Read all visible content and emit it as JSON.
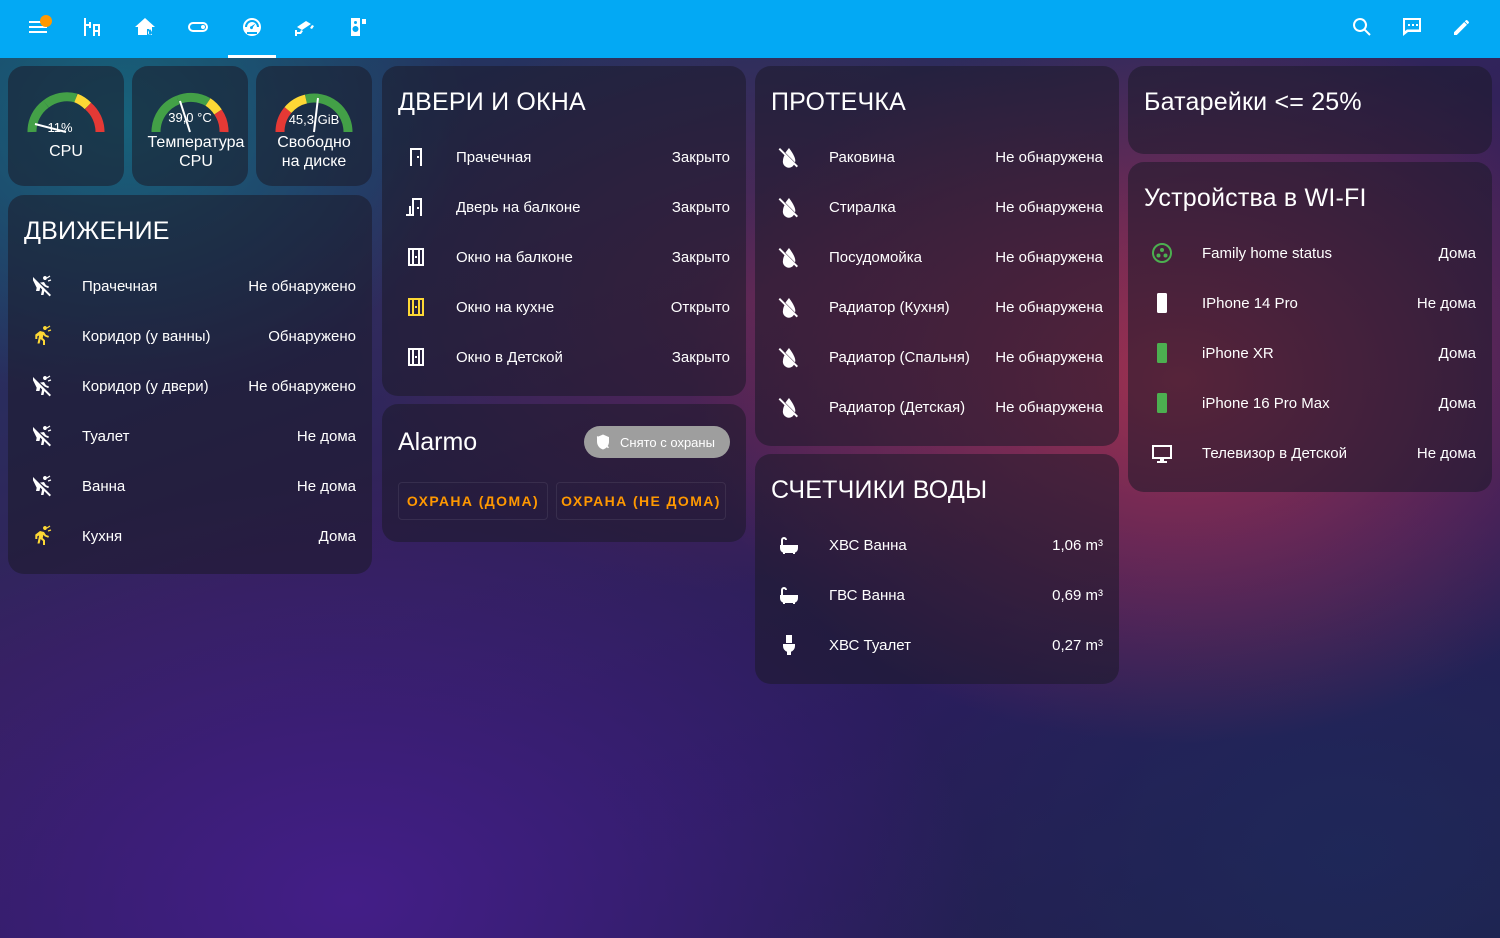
{
  "topbar": {
    "icons": [
      "menu-icon",
      "floor-plan-icon",
      "home-flood-icon",
      "toggle-switch-icon",
      "speedometer-icon",
      "cctv-icon",
      "speaker-icon",
      "search-icon",
      "chat-icon",
      "pencil-icon"
    ],
    "accent": "#03a9f4"
  },
  "gauges": [
    {
      "value": "11%",
      "name": "CPU",
      "level": 0.11
    },
    {
      "value": "39,0 °C",
      "name": "Температура CPU",
      "level": 0.39
    },
    {
      "value": "45,3 GiB",
      "name": "Свободно на диске",
      "level": 0.45
    }
  ],
  "motion": {
    "title": "ДВИЖЕНИЕ",
    "rows": [
      {
        "label": "Прачечная",
        "value": "Не обнаружено",
        "active": false
      },
      {
        "label": "Коридор (у ванны)",
        "value": "Обнаружено",
        "active": true
      },
      {
        "label": "Коридор (у двери)",
        "value": "Не обнаружено",
        "active": false
      },
      {
        "label": "Туалет",
        "value": "Не дома",
        "active": false
      },
      {
        "label": "Ванна",
        "value": "Не дома",
        "active": false
      },
      {
        "label": "Кухня",
        "value": "Дома",
        "active": true
      }
    ]
  },
  "doors": {
    "title": "ДВЕРИ И ОКНА",
    "rows": [
      {
        "label": "Прачечная",
        "value": "Закрыто",
        "icon": "door-icon",
        "open": false
      },
      {
        "label": "Дверь на балконе",
        "value": "Закрыто",
        "icon": "balcony-door-icon",
        "open": false
      },
      {
        "label": "Окно на балконе",
        "value": "Закрыто",
        "icon": "window-icon",
        "open": false
      },
      {
        "label": "Окно на кухне",
        "value": "Открыто",
        "icon": "window-icon",
        "open": true
      },
      {
        "label": "Окно в Детской",
        "value": "Закрыто",
        "icon": "window-icon",
        "open": false
      }
    ]
  },
  "alarmo": {
    "title": "Alarmo",
    "state": "Снято с охраны",
    "arm_home": "ОХРАНА (ДОМА)",
    "arm_away": "ОХРАНА (НЕ ДОМА)",
    "button_color": "#ff9800"
  },
  "leak": {
    "title": "ПРОТЕЧКА",
    "rows": [
      {
        "label": "Раковина",
        "value": "Не обнаружена"
      },
      {
        "label": "Стиралка",
        "value": "Не обнаружена"
      },
      {
        "label": "Посудомойка",
        "value": "Не обнаружена"
      },
      {
        "label": "Радиатор (Кухня)",
        "value": "Не обнаружена"
      },
      {
        "label": "Радиатор (Спальня)",
        "value": "Не обнаружена"
      },
      {
        "label": "Радиатор (Детская)",
        "value": "Не обнаружена"
      }
    ]
  },
  "water": {
    "title": "СЧЕТЧИКИ ВОДЫ",
    "rows": [
      {
        "label": "ХВС Ванна",
        "value": "1,06 m³",
        "icon": "bathtub-icon"
      },
      {
        "label": "ГВС Ванна",
        "value": "0,69 m³",
        "icon": "bathtub-icon"
      },
      {
        "label": "ХВС Туалет",
        "value": "0,27 m³",
        "icon": "toilet-icon"
      }
    ]
  },
  "battery": {
    "title": "Батарейки <= 25%"
  },
  "wifi": {
    "title": "Устройства в WI-FI",
    "rows": [
      {
        "label": "Family home status",
        "value": "Дома",
        "icon": "group-icon"
      },
      {
        "label": "IPhone 14 Pro",
        "value": "Не дома",
        "icon": "phone-icon"
      },
      {
        "label": "iPhone XR",
        "value": "Дома",
        "icon": "phone-icon"
      },
      {
        "label": "iPhone 16 Pro Max",
        "value": "Дома",
        "icon": "phone-icon"
      },
      {
        "label": "Телевизор в Детской",
        "value": "Не дома",
        "icon": "tv-icon"
      }
    ]
  },
  "colors": {
    "active_icon": "#fdd835",
    "home_green": "#4caf50",
    "gauge_green": "#43a047",
    "gauge_yellow": "#fdd835",
    "gauge_red": "#e53935"
  }
}
